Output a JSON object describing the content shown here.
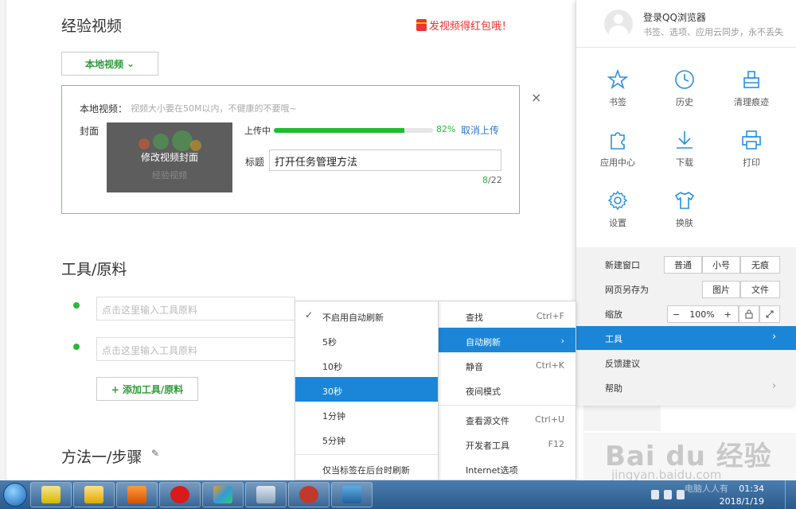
{
  "editor": {
    "section_title": "经验视频",
    "promo": "发视频得红包哦！",
    "local_video_button": "本地视频",
    "upload": {
      "label": "本地视频：",
      "hint": "视频大小要在50M以内，不健康的不要哦~",
      "cover_label": "封面",
      "cover_overlay_text": "修改视频封面",
      "cover_watermark": "经验视频",
      "uploading_label": "上传中",
      "progress_percent": 82,
      "progress_text": "82%",
      "cancel_upload": "取消上传",
      "title_label": "标题",
      "title_value": "打开任务管理方法",
      "char_count": "8",
      "char_max": "/22",
      "close": "×"
    },
    "tools_title": "工具/原料",
    "tool_placeholder_1": "点击这里输入工具原料",
    "tool_placeholder_2": "点击这里输入工具原料",
    "add_tool_button": "+ 添加工具/原料",
    "method_title": "方法一/步骤",
    "edit_icon_glyph": "✎"
  },
  "browser_menu": {
    "login_title": "登录QQ浏览器",
    "login_sub": "书签、选项、应用云同步，永不丢失",
    "grid": [
      {
        "label": "书签",
        "icon": "star-icon"
      },
      {
        "label": "历史",
        "icon": "clock-icon"
      },
      {
        "label": "清理痕迹",
        "icon": "eraser-icon"
      },
      {
        "label": "应用中心",
        "icon": "puzzle-icon"
      },
      {
        "label": "下载",
        "icon": "download-icon"
      },
      {
        "label": "打印",
        "icon": "printer-icon"
      },
      {
        "label": "设置",
        "icon": "gear-icon"
      },
      {
        "label": "换肤",
        "icon": "shirt-icon"
      }
    ],
    "new_window_label": "新建窗口",
    "new_window_options": [
      "普通",
      "小号",
      "无痕"
    ],
    "save_as_label": "网页另存为",
    "save_as_options": [
      "图片",
      "文件"
    ],
    "zoom_label": "缩放",
    "zoom_minus": "−",
    "zoom_value": "100%",
    "zoom_plus": "+",
    "tools_label": "工具",
    "feedback_label": "反馈建议",
    "help_label": "帮助",
    "arrow": "›"
  },
  "tools_submenu": [
    {
      "label": "查找",
      "shortcut": "Ctrl+F"
    },
    {
      "label": "自动刷新",
      "shortcut": "›"
    },
    {
      "label": "静音",
      "shortcut": "Ctrl+K"
    },
    {
      "label": "夜间模式",
      "shortcut": ""
    },
    {
      "label": "查看源文件",
      "shortcut": "Ctrl+U"
    },
    {
      "label": "开发者工具",
      "shortcut": "F12"
    },
    {
      "label": "Internet选项",
      "shortcut": ""
    }
  ],
  "refresh_submenu": [
    {
      "label": "不启用自动刷新",
      "checked": "✓"
    },
    {
      "label": "5秒"
    },
    {
      "label": "10秒"
    },
    {
      "label": "30秒"
    },
    {
      "label": "1分钟"
    },
    {
      "label": "5分钟"
    },
    {
      "label": "仅当标签在后台时刷新"
    }
  ],
  "watermark": {
    "baidu": "Bai du 经验",
    "site": "jingyan.baidu.com"
  },
  "taskbar": {
    "time": "01:34",
    "date": "2018/1/19",
    "tray_text": "电脑人人有"
  },
  "colors": {
    "accent_blue": "#1b86d8",
    "green": "#1fbd30",
    "promo_red": "#e33"
  }
}
